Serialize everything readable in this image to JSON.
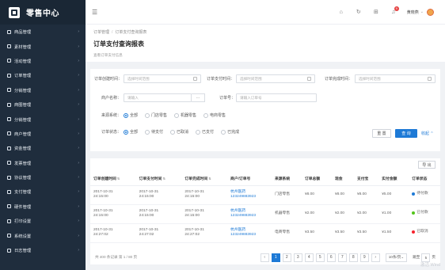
{
  "app": {
    "title": "零售中心"
  },
  "sidebar": {
    "items": [
      {
        "label": "商品管理",
        "icon": "shop-icon"
      },
      {
        "label": "素材管理",
        "icon": "file-icon"
      },
      {
        "label": "活动管理",
        "icon": "calendar-icon"
      },
      {
        "label": "订单管理",
        "icon": "order-icon"
      },
      {
        "label": "分销管理",
        "icon": "distribution-icon"
      },
      {
        "label": "商圈管理",
        "icon": "grid-icon"
      },
      {
        "label": "分销管理",
        "icon": "share-icon"
      },
      {
        "label": "商户管理",
        "icon": "merchant-icon"
      },
      {
        "label": "资金管理",
        "icon": "wallet-icon"
      },
      {
        "label": "发票管理",
        "icon": "invoice-icon"
      },
      {
        "label": "协议管理",
        "icon": "agreement-icon"
      },
      {
        "label": "支付管理",
        "icon": "card-icon"
      },
      {
        "label": "硬件管理",
        "icon": "device-icon"
      },
      {
        "label": "打印设置",
        "icon": "printer-icon"
      },
      {
        "label": "系统设置",
        "icon": "gear-icon"
      },
      {
        "label": "日志管理",
        "icon": "log-icon"
      }
    ]
  },
  "header": {
    "username": "黄晓燕",
    "notification_count": "9"
  },
  "breadcrumb": {
    "parent": "订单管理",
    "current": "订单支付查询报表"
  },
  "page": {
    "title": "订单支付查询报表",
    "description": "查看订单支付信息"
  },
  "filters": {
    "create_time_label": "订单创建时间：",
    "pay_time_label": "订单支付时间：",
    "finish_time_label": "订单完成时间：",
    "date_placeholder": "选择时间范围",
    "merchant_label": "商户名称：",
    "merchant_placeholder": "请输入",
    "order_no_label": "订单号：",
    "order_no_placeholder": "请输入订单号",
    "source_label": "来源系统：",
    "source_options": [
      "全部",
      "门店零售",
      "机器零售",
      "电商零售"
    ],
    "source_selected": "全部",
    "status_label": "订单状态：",
    "status_options": [
      "全部",
      "待支付",
      "已取消",
      "已支付",
      "已完成"
    ],
    "status_selected": "全部",
    "reset_label": "重 置",
    "search_label": "查 询",
    "collapse_label": "收起"
  },
  "table": {
    "export_label": "导 出",
    "columns": [
      "订单创建时间",
      "订单支付时间",
      "订单完成时间",
      "商户/订单号",
      "来源系统",
      "订单总额",
      "现金",
      "支付宝",
      "实付金额",
      "订单状态"
    ],
    "rows": [
      {
        "created": [
          "2017-10-31",
          "24:15:00"
        ],
        "paid": [
          "2017-10-31",
          "24:15:00"
        ],
        "finished": [
          "2017-10-31",
          "24:15:00"
        ],
        "shop": "杭州医药",
        "order_no": "123249883923",
        "source": "门店零售",
        "total": "¥8.00",
        "cash": "¥8.00",
        "alipay": "¥8.00",
        "actual": "¥5.00",
        "status": "待付款",
        "status_color": "#1e7ad6"
      },
      {
        "created": [
          "2017-10-31",
          "24:15:00"
        ],
        "paid": [
          "2017-10-31",
          "24:15:00"
        ],
        "finished": [
          "2017-10-31",
          "24:15:00"
        ],
        "shop": "杭州医药",
        "order_no": "123249883923",
        "source": "机器零售",
        "total": "¥2.00",
        "cash": "¥2.00",
        "alipay": "¥2.00",
        "actual": "¥1.00",
        "status": "已付款",
        "status_color": "#52c41a"
      },
      {
        "created": [
          "2017-10-31",
          "24:27:02"
        ],
        "paid": [
          "2017-10-31",
          "24:27:02"
        ],
        "finished": [
          "2017-10-31",
          "24:27:02"
        ],
        "shop": "杭州医药",
        "order_no": "123249883923",
        "source": "电商零售",
        "total": "¥3.50",
        "cash": "¥3.50",
        "alipay": "¥3.50",
        "actual": "¥1.50",
        "status": "已取消",
        "status_color": "#f5222d"
      }
    ]
  },
  "pagination": {
    "summary": "共 400 条记录 第 1 / 80 页",
    "pages": [
      "1",
      "2",
      "3",
      "4",
      "5",
      "6",
      "7",
      "8",
      "9"
    ],
    "active_page": "1",
    "page_size": "10条/页",
    "jump_label": "跳至",
    "jump_value": "5",
    "page_unit": "页"
  },
  "watermark": "激活 Wind",
  "colors": {
    "sidebar": "#1f2d3d",
    "primary": "#1e7ad6"
  }
}
